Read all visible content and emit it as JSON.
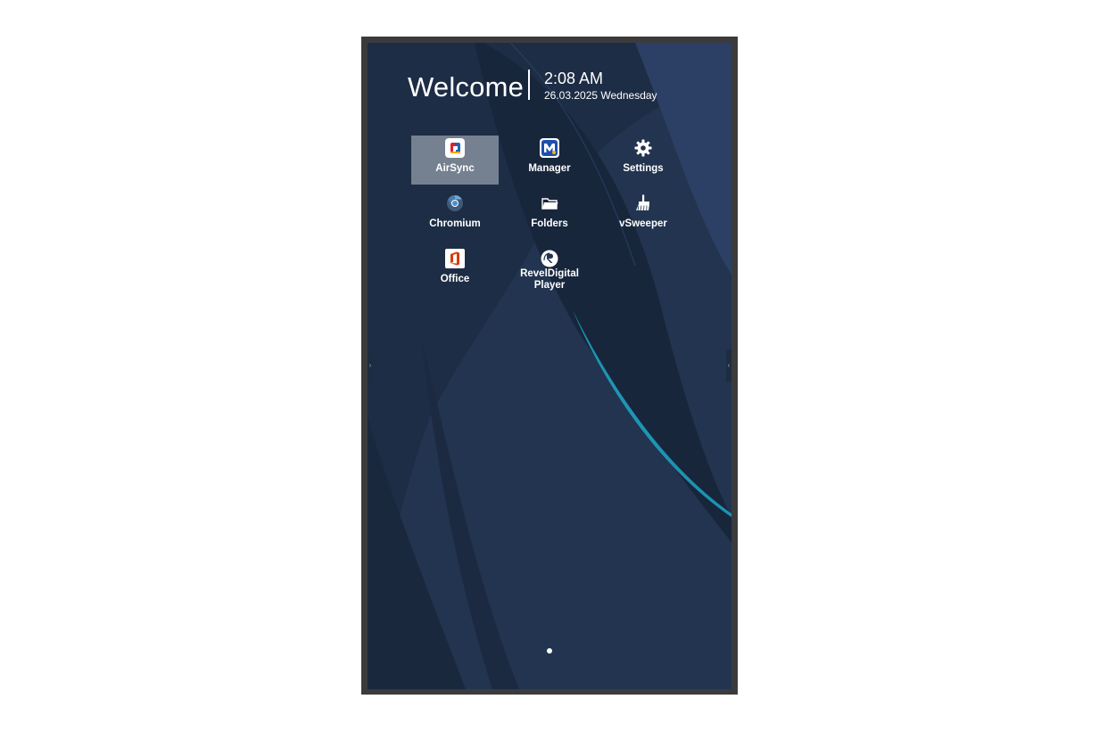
{
  "header": {
    "welcome": "Welcome",
    "time": "2:08 AM",
    "date": "26.03.2025 Wednesday"
  },
  "apps": [
    {
      "label": "AirSync",
      "icon": "airsync-icon",
      "selected": true
    },
    {
      "label": "Manager",
      "icon": "manager-icon"
    },
    {
      "label": "Settings",
      "icon": "gear-icon"
    },
    {
      "label": "Chromium",
      "icon": "chromium-icon"
    },
    {
      "label": "Folders",
      "icon": "folder-icon"
    },
    {
      "label": "vSweeper",
      "icon": "broom-icon"
    },
    {
      "label": "Office",
      "icon": "office-icon"
    },
    {
      "label": "RevelDigital Player",
      "icon": "reveldigital-icon"
    }
  ],
  "colors": {
    "wallpaper_base": "#22344f",
    "wallpaper_dark": "#17243a",
    "accent_line": "#1fa7c4",
    "bezel": "#3b3b3d"
  },
  "pager": {
    "pages": 1,
    "current": 1
  },
  "edge_handles": {
    "left": "›",
    "right": "‹"
  }
}
